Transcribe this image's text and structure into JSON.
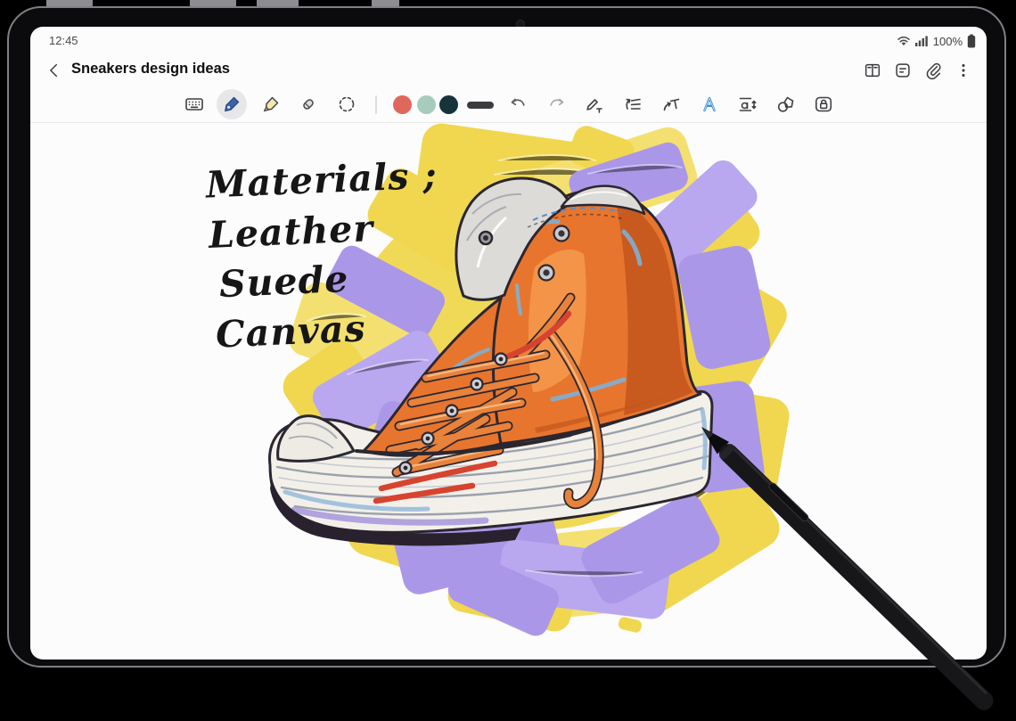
{
  "status_bar": {
    "time": "12:45",
    "battery_percent": "100%",
    "icons": [
      "wifi-icon",
      "signal-strength-icon",
      "battery-icon"
    ]
  },
  "title_bar": {
    "title": "Sneakers design ideas",
    "back_icon": "back-chevron-icon",
    "action_icons": [
      "reading-mode-icon",
      "page-list-icon",
      "attachment-icon",
      "more-options-icon"
    ]
  },
  "toolbar": {
    "selected_tool": "pen",
    "tools": [
      "keyboard-tool",
      "pen-tool",
      "highlighter-tool",
      "eraser-tool",
      "lasso-select-tool"
    ],
    "palette": [
      {
        "name": "coral",
        "hex": "#df675c"
      },
      {
        "name": "mint",
        "hex": "#a7ccbd"
      },
      {
        "name": "dark-teal",
        "hex": "#17333c"
      }
    ],
    "stroke_preview_color": "#3c3c40",
    "pen_accent_color": "#3c63a8",
    "history": {
      "undo_enabled": true,
      "redo_enabled": false
    },
    "handwriting_tools": [
      "convert-to-text-tool",
      "straighten-tool",
      "tilt-text-tool",
      "auto-beautify-tool",
      "text-spacing-tool",
      "shape-recognition-tool",
      "lock-canvas-tool"
    ]
  },
  "canvas": {
    "note_lines": [
      "Materials ;",
      "Leather",
      "Suede",
      "Canvas"
    ],
    "artwork": {
      "subject": "orange high-top sneaker illustration with yellow and purple brush strokes",
      "colors": {
        "yellow": "#f0d74f",
        "purple": "#ab97e8",
        "orange": "#e8752e",
        "orange_shade": "#c2561d",
        "lace_orange": "#e9823a",
        "accent_red": "#d6432f",
        "accent_blue": "#7fb0d6",
        "sole_white": "#f3f0ea",
        "silver": "#dcdbd7",
        "ink_outline": "#2b2730"
      }
    }
  },
  "device": {
    "stylus": "s-pen",
    "frame": "tablet-bezel"
  }
}
